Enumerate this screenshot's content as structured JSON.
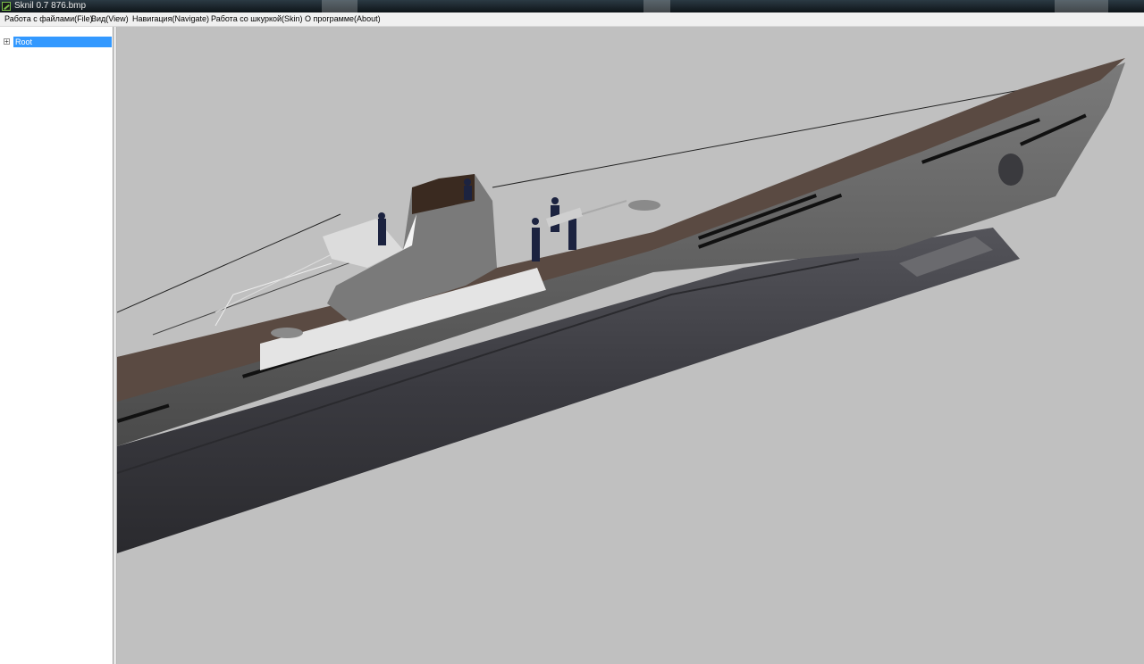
{
  "window": {
    "title": "Sknil 0.7   876.bmp"
  },
  "menu": {
    "items": [
      {
        "label": "Работа с файлами(File)"
      },
      {
        "label": "Вид(View)"
      },
      {
        "label": "Навигация(Navigate)"
      },
      {
        "label": "Работа со шкуркой(Skin)"
      },
      {
        "label": "О программе(About)"
      }
    ]
  },
  "tree": {
    "root": {
      "label": "Root",
      "expander": "+",
      "selected": true
    }
  },
  "viewport": {
    "background": "#c0c0c0",
    "model": "submarine-3d-model"
  },
  "colors": {
    "selection": "#3399ff",
    "hull_dark": "#3f3f45",
    "deck": "#5a4a42",
    "titlebar": "#0e1418"
  }
}
